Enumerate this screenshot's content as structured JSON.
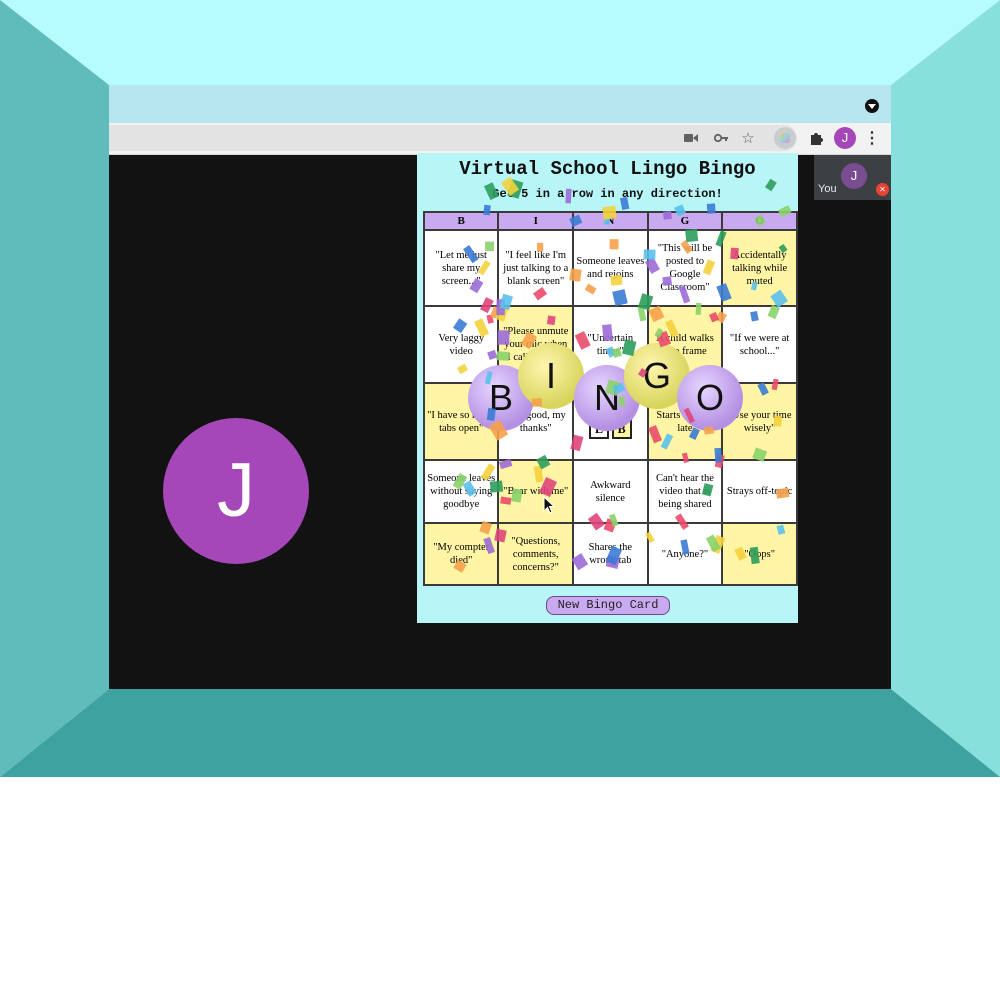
{
  "browser": {
    "profile_initial": "J"
  },
  "meet": {
    "participant_initial": "J",
    "self_initial": "J",
    "self_label": "You"
  },
  "bingo": {
    "title": "Virtual School Lingo Bingo",
    "subtitle": "Get 5 in a row in any direction!",
    "columns": [
      "B",
      "I",
      "N",
      "G",
      "O"
    ],
    "rows": [
      [
        "\"Let me just share my screen...\"",
        "\"I feel like I'm just talking to a blank screen\"",
        "Someone leaves and rejoins",
        "\"This will be posted to Google Classroom\"",
        "Accidentally talking while muted"
      ],
      [
        "Very laggy video",
        "\"Please unmute your mic when I call on you\"",
        "\"Uncertain times\"",
        "A child walks into frame",
        "\"If we were at school...\""
      ],
      [
        "\"I have so many tabs open\"",
        "\"I'm good, my thanks\"",
        "",
        "Starts the call late",
        "\"Use your time wisely\""
      ],
      [
        "Someone leaves without saying goodbye",
        "\"Bear with me\"",
        "Awkward silence",
        "Can't hear the video that is being shared",
        "Strays off-topic"
      ],
      [
        "\"My compter died\"",
        "\"Questions, comments, concerns?\"",
        "Shares the wrong tab",
        "\"Anyone?\"",
        "\"Oops\""
      ]
    ],
    "free_space": [
      "L",
      "B"
    ],
    "banner_letters": [
      "B",
      "I",
      "N",
      "G",
      "O"
    ],
    "new_card_label": "New Bingo Card"
  },
  "colors": {
    "marked_cell": "#fff5a4",
    "header_cell": "#c9a9ef",
    "popup_bg": "#b8f5f7",
    "avatar": "#a547b8"
  }
}
